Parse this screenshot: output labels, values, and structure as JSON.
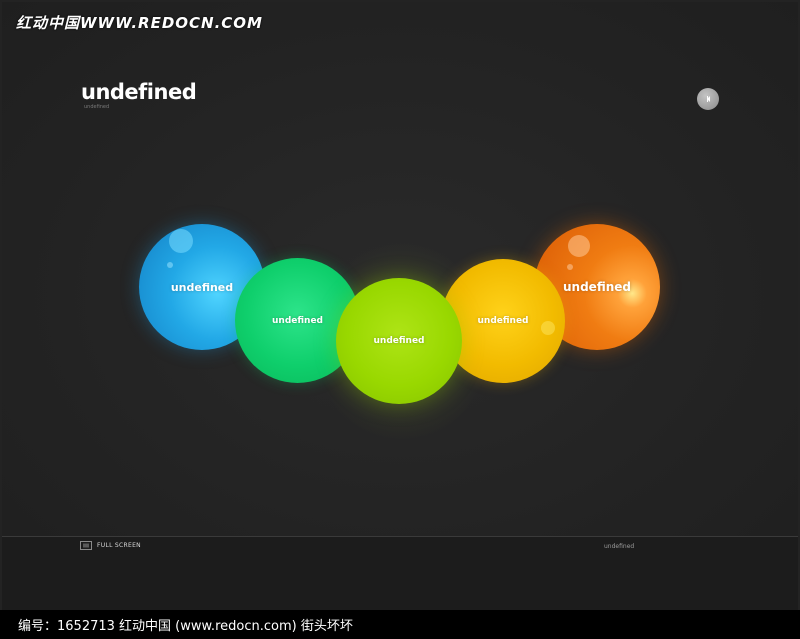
{
  "watermark": {
    "text": "红动中国WWW.REDOCN.COM"
  },
  "header": {
    "title": "undefined",
    "subtitle": "undefined"
  },
  "nav": {
    "back_icon": "chevron-left-icon"
  },
  "balls": [
    {
      "label": "undefined",
      "color": "#1e9fe0"
    },
    {
      "label": "undefined",
      "color": "#10cc6a"
    },
    {
      "label": "undefined",
      "color": "#99d800"
    },
    {
      "label": "undefined",
      "color": "#f0b800"
    },
    {
      "label": "undefined",
      "color": "#f06a00"
    }
  ],
  "footer": {
    "fullscreen_label": "FULL SCREEN",
    "fullscreen_icon": "fullscreen-icon",
    "right_text": "undefined"
  },
  "caption": {
    "text": "编号：1652713     红动中国 (www.redocn.com)     街头坏坏"
  }
}
